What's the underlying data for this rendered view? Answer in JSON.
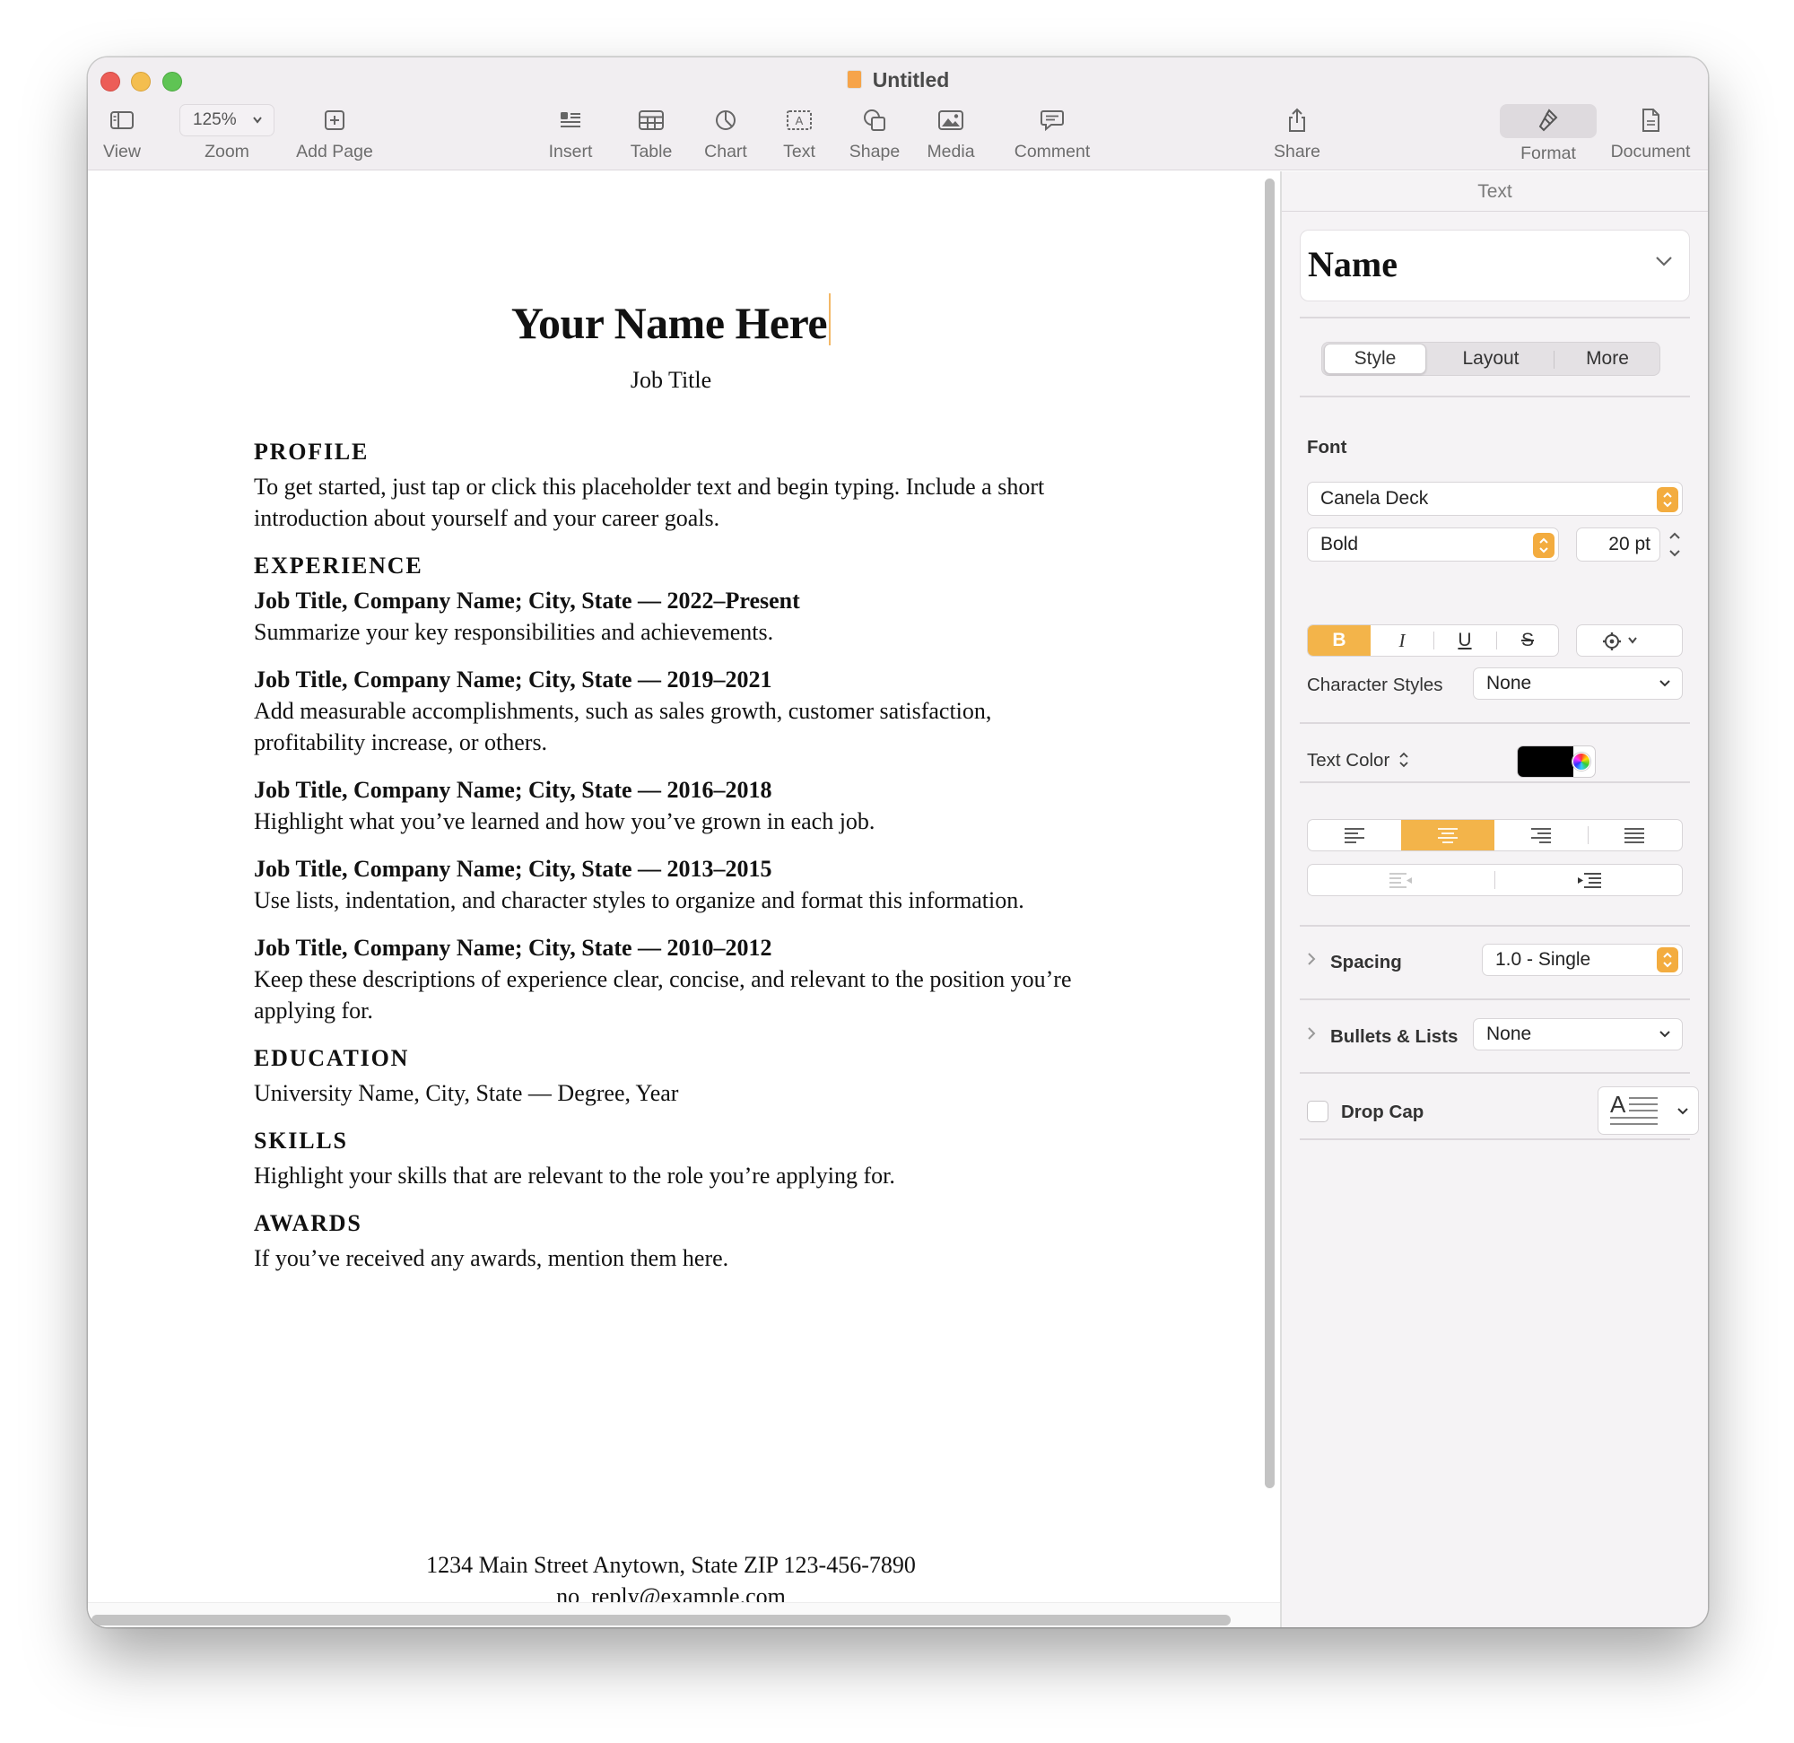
{
  "window": {
    "title": "Untitled"
  },
  "toolbar": {
    "view": "View",
    "zoom_value": "125%",
    "zoom": "Zoom",
    "add_page": "Add Page",
    "insert": "Insert",
    "table": "Table",
    "chart": "Chart",
    "text": "Text",
    "shape": "Shape",
    "media": "Media",
    "comment": "Comment",
    "share": "Share",
    "format": "Format",
    "document": "Document"
  },
  "document": {
    "name": "Your Name Here",
    "job_title": "Job Title",
    "profile_heading": "PROFILE",
    "profile_text_1": "To get started, just tap or click this placeholder text and begin typing. Include a short",
    "profile_text_2": "introduction about yourself and your career goals.",
    "experience_heading": "EXPERIENCE",
    "jobs": [
      {
        "title": "Job Title, Company Name; City, State — 2022–Present",
        "lines": [
          "Summarize your key responsibilities and achievements."
        ]
      },
      {
        "title": "Job Title, Company Name; City, State — 2019–2021",
        "lines": [
          "Add measurable accomplishments, such as sales growth, customer satisfaction,",
          "profitability increase, or others."
        ]
      },
      {
        "title": "Job Title, Company Name; City, State — 2016–2018",
        "lines": [
          "Highlight what you’ve learned and how you’ve grown in each job."
        ]
      },
      {
        "title": "Job Title, Company Name; City, State — 2013–2015",
        "lines": [
          "Use lists, indentation, and character styles to organize and format this information."
        ]
      },
      {
        "title": "Job Title, Company Name; City, State — 2010–2012",
        "lines": [
          "Keep these descriptions of experience clear, concise, and relevant to the position you’re",
          "applying for."
        ]
      }
    ],
    "education_heading": "EDUCATION",
    "education_text": "University Name, City, State — Degree, Year",
    "skills_heading": "SKILLS",
    "skills_text": "Highlight your skills that are relevant to the role you’re applying for.",
    "awards_heading": "AWARDS",
    "awards_text": "If you’ve received any awards, mention them here.",
    "footer_address": "1234 Main Street Anytown, State ZIP   123-456-7890",
    "footer_email": "no_reply@example.com"
  },
  "sidebar": {
    "title": "Text",
    "paragraph_style": "Name",
    "tabs": [
      "Style",
      "Layout",
      "More"
    ],
    "active_tab": "Style",
    "font_label": "Font",
    "font_family": "Canela Deck",
    "font_typeface": "Bold",
    "font_size": "20 pt",
    "bold": "B",
    "italic": "I",
    "underline": "U",
    "strike": "S",
    "character_styles_label": "Character Styles",
    "character_styles_value": "None",
    "text_color_label": "Text Color",
    "text_color": "#000000",
    "alignment_active": "center",
    "spacing_label": "Spacing",
    "spacing_value": "1.0 - Single",
    "bullets_label": "Bullets & Lists",
    "bullets_value": "None",
    "drop_cap_label": "Drop Cap",
    "drop_cap_checked": false,
    "drop_cap_preview_letter": "A"
  },
  "colors": {
    "accent": "#f3b44a",
    "toolbar_bg": "#f1eef1",
    "sidebar_bg": "#f5f3f5"
  }
}
